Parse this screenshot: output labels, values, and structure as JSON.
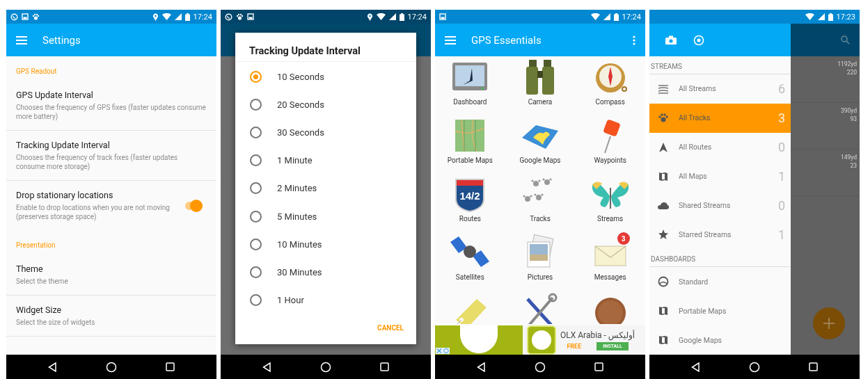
{
  "phones": [
    {
      "kind": "settings",
      "time": "17:24",
      "title": "Settings",
      "groups": [
        {
          "header": "GPS Readout",
          "items": [
            {
              "kind": "text",
              "title": "GPS Update Interval",
              "summary": "Chooses the frequency of GPS fixes (faster updates consume more battery)"
            },
            {
              "kind": "text",
              "title": "Tracking Update Interval",
              "summary": "Chooses the frequency of track fixes (faster updates consume more storage)"
            },
            {
              "kind": "switch",
              "title": "Drop stationary locations",
              "summary": "Enable to drop locations when you are not moving (preserves storage space)",
              "checked": true
            }
          ]
        },
        {
          "header": "Presentation",
          "items": [
            {
              "kind": "text",
              "title": "Theme",
              "summary": "Select the theme"
            },
            {
              "kind": "text",
              "title": "Widget Size",
              "summary": "Select the size of widgets"
            }
          ]
        }
      ]
    },
    {
      "kind": "dialog",
      "time": "17:24",
      "dialog": {
        "title": "Tracking Update Interval",
        "options": [
          {
            "label": "10 Seconds",
            "selected": true
          },
          {
            "label": "20 Seconds",
            "selected": false
          },
          {
            "label": "30 Seconds",
            "selected": false
          },
          {
            "label": "1 Minute",
            "selected": false
          },
          {
            "label": "2 Minutes",
            "selected": false
          },
          {
            "label": "5 Minutes",
            "selected": false
          },
          {
            "label": "10 Minutes",
            "selected": false
          },
          {
            "label": "30 Minutes",
            "selected": false
          },
          {
            "label": "1 Hour",
            "selected": false
          }
        ],
        "button": "CANCEL"
      }
    },
    {
      "kind": "grid",
      "time": "17:24",
      "title": "GPS Essentials",
      "tiles": [
        {
          "label": "Dashboard"
        },
        {
          "label": "Camera"
        },
        {
          "label": "Compass"
        },
        {
          "label": "Portable Maps"
        },
        {
          "label": "Google Maps"
        },
        {
          "label": "Waypoints"
        },
        {
          "label": "Routes",
          "sign": "14/2"
        },
        {
          "label": "Tracks"
        },
        {
          "label": "Streams"
        },
        {
          "label": "Satellites"
        },
        {
          "label": "Pictures"
        },
        {
          "label": "Messages",
          "badge": "3"
        }
      ],
      "ad": {
        "title": "OLX Arabia - أوليكس",
        "price": "FREE",
        "button": "INSTALL"
      }
    },
    {
      "kind": "drawer",
      "time": "17:23",
      "sections": [
        {
          "header": "STREAMS",
          "items": [
            {
              "label": "All Streams",
              "count": "6",
              "selected": false
            },
            {
              "label": "All Tracks",
              "count": "3",
              "selected": true
            },
            {
              "label": "All Routes",
              "count": "0",
              "selected": false
            },
            {
              "label": "All Maps",
              "count": "1",
              "selected": false
            },
            {
              "label": "Shared Streams",
              "count": "0",
              "selected": false
            },
            {
              "label": "Starred Streams",
              "count": "1",
              "selected": false
            }
          ]
        },
        {
          "header": "DASHBOARDS",
          "items": [
            {
              "label": "Standard",
              "selected": false
            },
            {
              "label": "Portable Maps",
              "selected": false
            },
            {
              "label": "Google Maps",
              "selected": false
            }
          ]
        }
      ],
      "background_rows": [
        {
          "distance": "1192yd",
          "count": "220"
        },
        {
          "distance": "390yd",
          "count": "93"
        },
        {
          "distance": "149yd",
          "count": "23"
        }
      ]
    }
  ]
}
